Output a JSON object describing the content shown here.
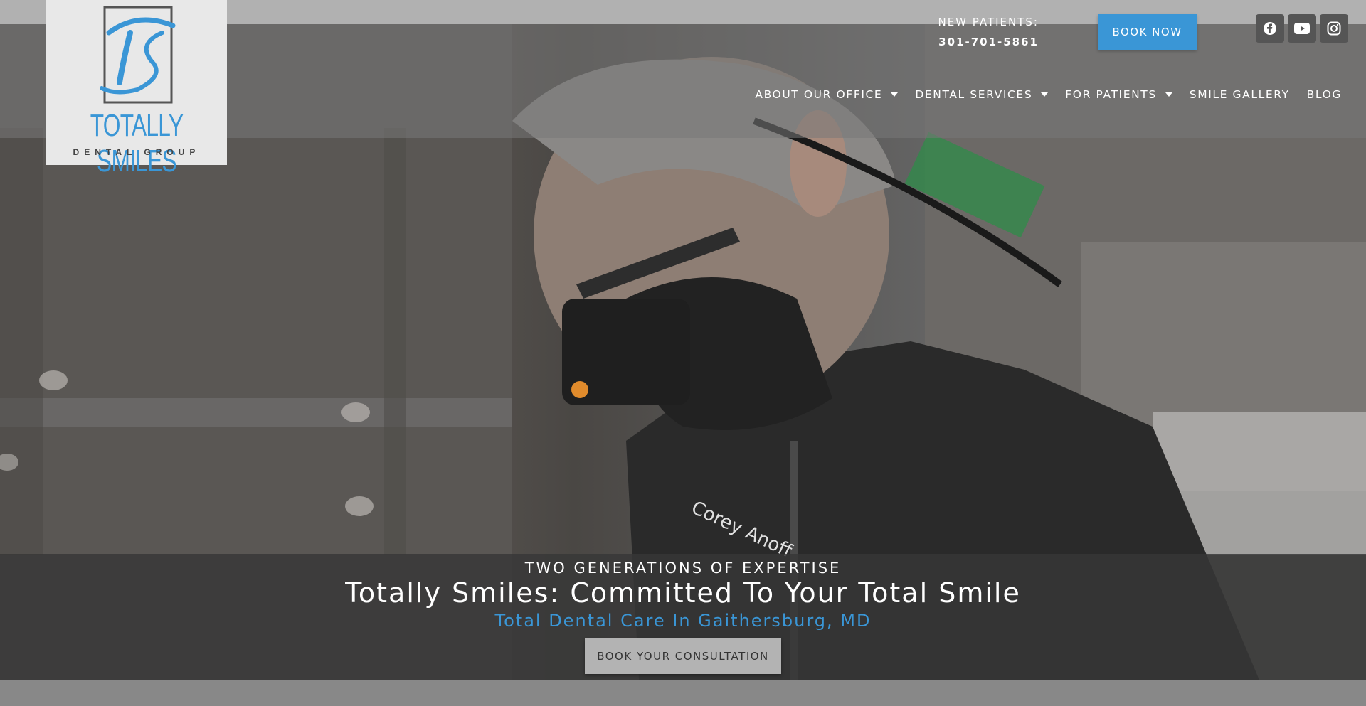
{
  "header": {
    "logo": {
      "name": "TOTALLY SMILES",
      "subtitle": "DENTAL GROUP"
    },
    "new_patients_label": "NEW PATIENTS:",
    "phone": "301-701-5861",
    "book_now_label": "BOOK NOW",
    "social": [
      {
        "icon": "facebook-icon"
      },
      {
        "icon": "youtube-icon"
      },
      {
        "icon": "instagram-icon"
      }
    ]
  },
  "nav": {
    "items": [
      {
        "label": "ABOUT OUR OFFICE",
        "has_dropdown": true
      },
      {
        "label": "DENTAL SERVICES",
        "has_dropdown": true
      },
      {
        "label": "FOR PATIENTS",
        "has_dropdown": true
      },
      {
        "label": "SMILE GALLERY",
        "has_dropdown": false
      },
      {
        "label": "BLOG",
        "has_dropdown": false
      }
    ]
  },
  "hero": {
    "eyebrow": "TWO GENERATIONS OF EXPERTISE",
    "headline": "Totally Smiles: Committed To Your Total Smile",
    "subheadline": "Total Dental Care In Gaithersburg, MD",
    "cta_label": "BOOK YOUR CONSULTATION"
  },
  "colors": {
    "accent": "#3a96d6",
    "topbar": "#b1b1b1",
    "cta_bg": "#b3b3b3"
  }
}
